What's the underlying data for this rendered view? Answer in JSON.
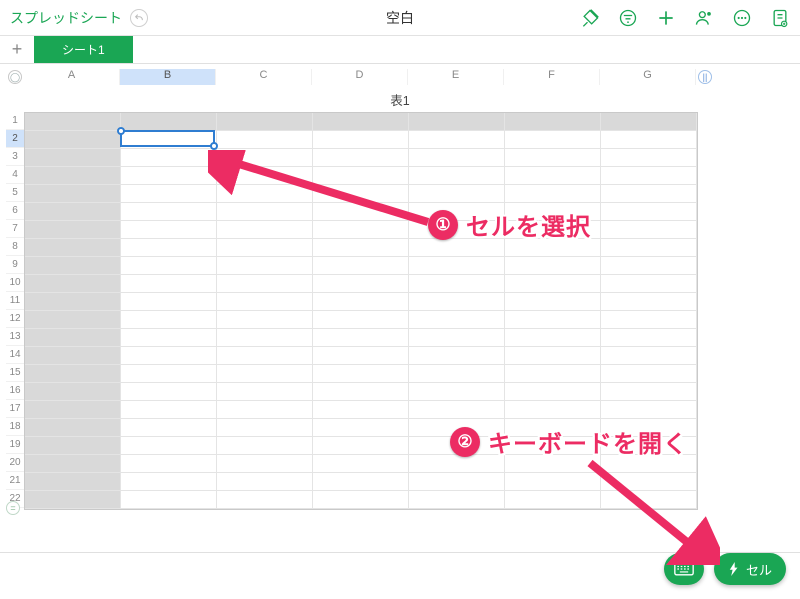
{
  "topbar": {
    "back_label": "スプレッドシート",
    "title": "空白"
  },
  "sheet_tabs": {
    "add": "+",
    "tab1": "シート1"
  },
  "table": {
    "title": "表1",
    "columns": [
      "A",
      "B",
      "C",
      "D",
      "E",
      "F",
      "G"
    ],
    "rows": [
      "1",
      "2",
      "3",
      "4",
      "5",
      "6",
      "7",
      "8",
      "9",
      "10",
      "11",
      "12",
      "13",
      "14",
      "15",
      "16",
      "17",
      "18",
      "19",
      "20",
      "21",
      "22"
    ],
    "selected": {
      "col": "B",
      "row": "2"
    }
  },
  "annotations": {
    "a1_badge": "①",
    "a1_text": "セルを選択",
    "a2_badge": "②",
    "a2_text": "キーボードを開く"
  },
  "fab": {
    "cell_label": "セル"
  },
  "corner_labels": {
    "origin": "○",
    "row_handle": "||",
    "footer": "="
  }
}
